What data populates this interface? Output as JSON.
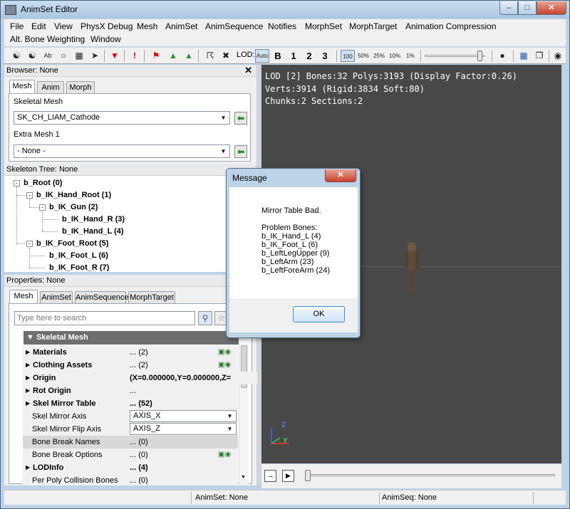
{
  "window": {
    "title": "AnimSet Editor",
    "controls": {
      "minimize": "–",
      "maximize": "□",
      "close": "✕"
    }
  },
  "menu": {
    "row1": [
      "File",
      "Edit",
      "View",
      "PhysX Debug",
      "Mesh",
      "AnimSet",
      "AnimSequence",
      "Notifies",
      "MorphSet",
      "MorphTarget",
      "Animation Compression"
    ],
    "row2": [
      "Alt. Bone Weighting",
      "Window"
    ]
  },
  "toolbar": {
    "lod_label": "LOD:",
    "lod_auto": "Auto",
    "lod_levels": [
      "B",
      "1",
      "2",
      "3"
    ],
    "playback_rates": [
      "100",
      "50%",
      "25%",
      "10%",
      "1%"
    ]
  },
  "browser": {
    "title": "Browser: None",
    "tabs": [
      "Mesh",
      "Anim",
      "Morph"
    ],
    "skeletal_mesh_label": "Skeletal Mesh",
    "skeletal_mesh_value": "SK_CH_LIAM_Cathode",
    "extra_mesh_label": "Extra Mesh 1",
    "extra_mesh_value": "- None -"
  },
  "skeleton_tree": {
    "title": "Skeleton Tree: None",
    "nodes": [
      "b_Root (0)",
      "b_IK_Hand_Root (1)",
      "b_IK_Gun (2)",
      "b_IK_Hand_R (3)",
      "b_IK_Hand_L (4)",
      "b_IK_Foot_Root (5)",
      "b_IK_Foot_L (6)",
      "b_IK_Foot_R (7)"
    ]
  },
  "properties": {
    "title": "Properties: None",
    "tabs": [
      "Mesh",
      "AnimSet",
      "AnimSequence",
      "MorphTarget"
    ],
    "search_placeholder": "Type here to search",
    "category": "Skeletal Mesh",
    "rows": [
      {
        "name": "Materials",
        "value": "... (2)"
      },
      {
        "name": "Clothing Assets",
        "value": "... (2)"
      },
      {
        "name": "Origin",
        "value": "(X=0.000000,Y=0.000000,Z="
      },
      {
        "name": "Rot Origin",
        "value": "..."
      },
      {
        "name": "Skel Mirror Table",
        "value": "... (52)"
      },
      {
        "name": "Skel Mirror Axis",
        "value": "AXIS_X"
      },
      {
        "name": "Skel Mirror Flip Axis",
        "value": "AXIS_Z"
      },
      {
        "name": "Bone Break Names",
        "value": "... (0)"
      },
      {
        "name": "Bone Break Options",
        "value": "... (0)"
      },
      {
        "name": "LODInfo",
        "value": "... (4)"
      },
      {
        "name": "Per Poly Collision Bones",
        "value": "... (0)"
      }
    ]
  },
  "viewport": {
    "stats": [
      "LOD [2] Bones:32 Polys:3193 (Display Factor:0.26)",
      "Verts:3914 (Rigid:3834 Soft:80)",
      "Chunks:2 Sections:2"
    ],
    "axis_labels": {
      "z": "Z",
      "y": "Y"
    }
  },
  "dialog": {
    "title": "Message",
    "lines": [
      "Mirror Table Bad.",
      "",
      "Problem Bones:",
      "b_IK_Hand_L (4)",
      "b_IK_Foot_L (6)",
      "b_LeftLegUpper (9)",
      "b_LeftArm (23)",
      "b_LeftForeArm (24)"
    ],
    "ok_label": "OK"
  },
  "status": {
    "animset": "AnimSet: None",
    "animseq": "AnimSeq: None"
  },
  "colors": {
    "viewport_bg": "#484848",
    "frame": "#bcd3e8",
    "close_red": "#c7432b"
  }
}
